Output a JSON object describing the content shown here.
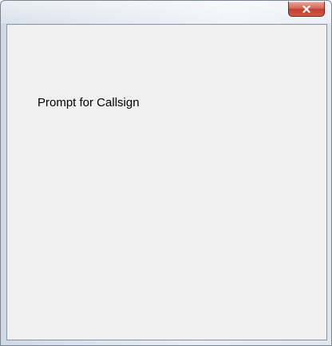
{
  "window": {
    "title": "",
    "close_icon": "close-icon"
  },
  "content": {
    "prompt_label": "Prompt for Callsign"
  }
}
